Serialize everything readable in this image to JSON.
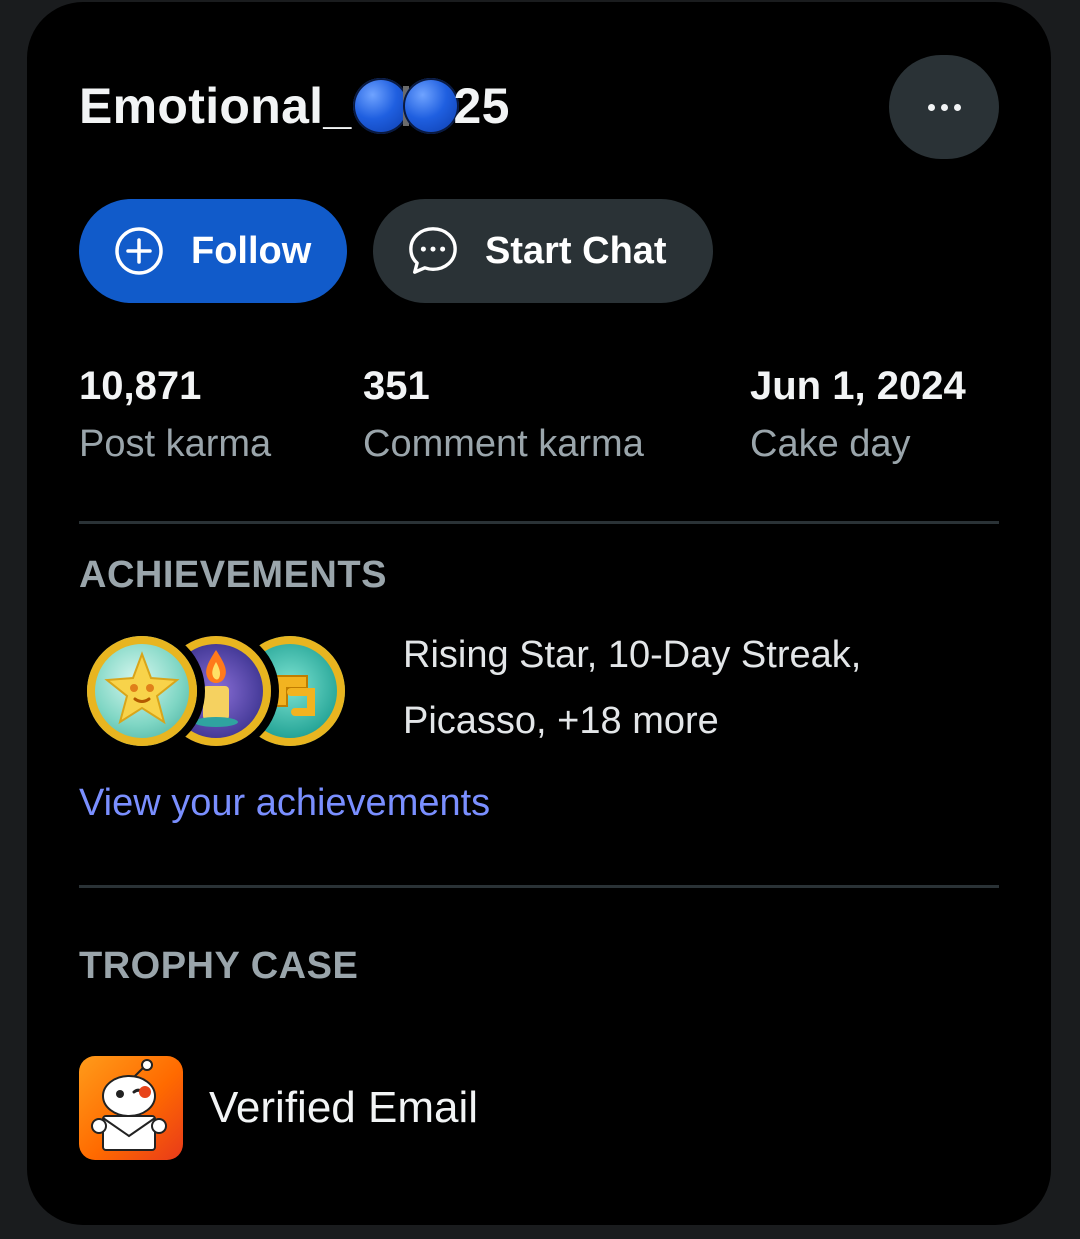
{
  "profile": {
    "username_prefix": "Emotional_",
    "username_suffix": "25",
    "more_icon": "more-horizontal-icon"
  },
  "actions": {
    "follow_label": "Follow",
    "follow_icon": "plus-circle-icon",
    "chat_label": "Start Chat",
    "chat_icon": "chat-bubble-icon"
  },
  "stats": [
    {
      "value": "10,871",
      "label": "Post karma"
    },
    {
      "value": "351",
      "label": "Comment karma"
    },
    {
      "value": "Jun 1, 2024",
      "label": "Cake day"
    }
  ],
  "achievements": {
    "title": "ACHIEVEMENTS",
    "summary_line1": "Rising Star, 10-Day Streak,",
    "summary_line2": "Picasso, +18 more",
    "link": "View your achievements",
    "badge_icons": [
      "rising-star-badge-icon",
      "streak-candle-badge-icon",
      "picasso-badge-icon"
    ]
  },
  "trophy_case": {
    "title": "TROPHY CASE",
    "items": [
      {
        "label": "Verified Email",
        "icon": "verified-email-trophy-icon"
      }
    ]
  },
  "colors": {
    "card_bg": "#000000",
    "page_bg": "#1a1c1e",
    "follow_bg": "#115bca",
    "secondary_bg": "#2a3236",
    "link": "#7a8fff",
    "muted": "#9aa5ab"
  }
}
